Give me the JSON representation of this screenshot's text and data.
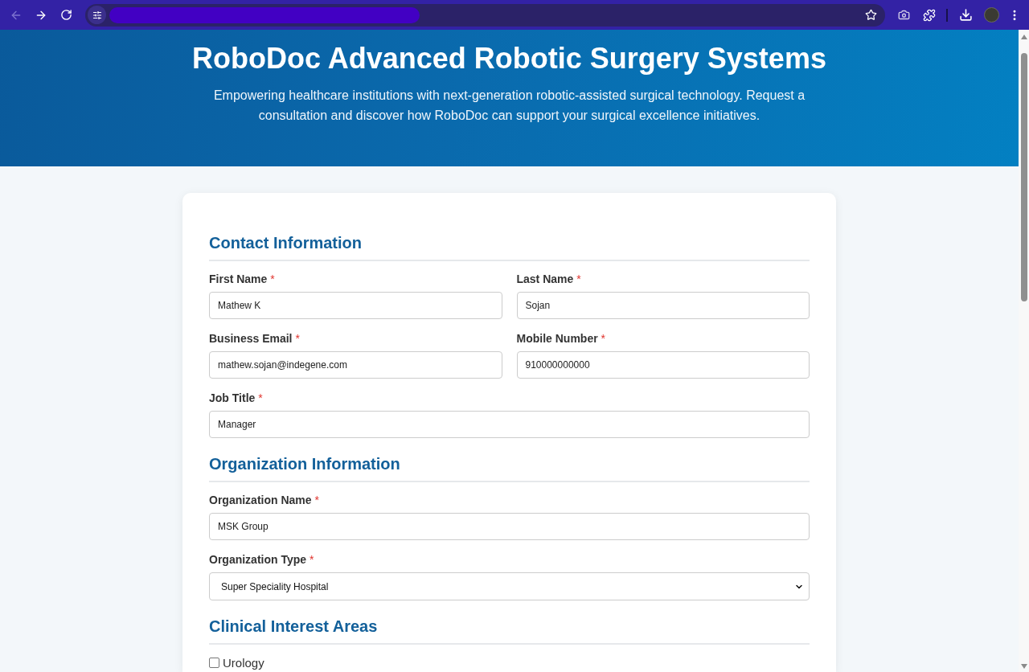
{
  "browser": {
    "back_disabled": true
  },
  "header": {
    "title": "RoboDoc Advanced Robotic Surgery Systems",
    "subtitle": "Empowering healthcare institutions with next-generation robotic-assisted surgical technology. Request a consultation and discover how RoboDoc can support your surgical excellence initiatives."
  },
  "sections": [
    {
      "heading": "Contact Information",
      "rows": [
        [
          {
            "kind": "text",
            "label": "First Name",
            "required_mark": "*",
            "value": "Mathew K"
          },
          {
            "kind": "text",
            "label": "Last Name",
            "required_mark": "*",
            "value": "Sojan"
          }
        ],
        [
          {
            "kind": "text",
            "label": "Business Email",
            "required_mark": "*",
            "value": "mathew.sojan@indegene.com"
          },
          {
            "kind": "text",
            "label": "Mobile Number",
            "required_mark": "*",
            "value": "910000000000"
          }
        ],
        [
          {
            "kind": "text",
            "label": "Job Title",
            "required_mark": "*",
            "value": "Manager"
          }
        ]
      ]
    },
    {
      "heading": "Organization Information",
      "rows": [
        [
          {
            "kind": "text",
            "label": "Organization Name",
            "required_mark": "*",
            "value": "MSK Group"
          }
        ],
        [
          {
            "kind": "select",
            "label": "Organization Type",
            "required_mark": "*",
            "value": "Super Speciality Hospital"
          }
        ]
      ]
    },
    {
      "heading": "Clinical Interest Areas",
      "rows": [
        [
          {
            "kind": "checkbox",
            "label": "Urology",
            "checked": false
          }
        ]
      ]
    }
  ]
}
